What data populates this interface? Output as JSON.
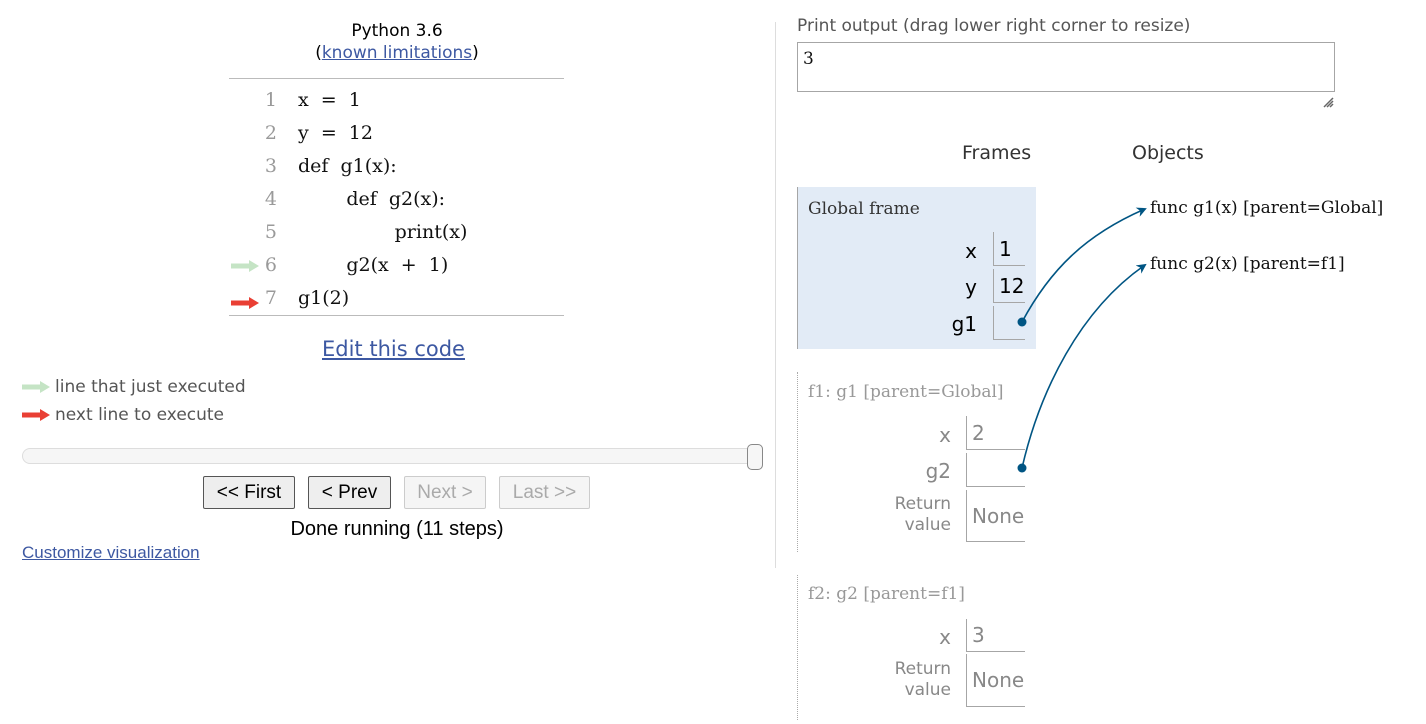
{
  "header": {
    "language": "Python 3.6",
    "limitations_open": "(",
    "limitations_link": "known limitations",
    "limitations_close": ")"
  },
  "code": {
    "lines": [
      {
        "number": "1",
        "text": "x  =  1",
        "marker": "none"
      },
      {
        "number": "2",
        "text": "y  =  12",
        "marker": "none"
      },
      {
        "number": "3",
        "text": "def  g1(x):",
        "marker": "none"
      },
      {
        "number": "4",
        "text": "        def  g2(x):",
        "marker": "none"
      },
      {
        "number": "5",
        "text": "                print(x)",
        "marker": "none"
      },
      {
        "number": "6",
        "text": "        g2(x  +  1)",
        "marker": "just-executed"
      },
      {
        "number": "7",
        "text": "g1(2)",
        "marker": "next-to-execute"
      }
    ]
  },
  "edit_link": "Edit this code",
  "legend": {
    "just_executed": "line that just executed",
    "next_line": "next line to execute",
    "just_executed_color": "#c5e4c5",
    "next_line_color": "#e93f34"
  },
  "navigation": {
    "slider_progress": 1.0,
    "first": "<< First",
    "prev": "< Prev",
    "next": "Next >",
    "last": "Last >>",
    "status": "Done running (11 steps)"
  },
  "customize_link": "Customize visualization",
  "print_output": {
    "label": "Print output (drag lower right corner to resize)",
    "value": "3"
  },
  "visualization": {
    "frames_heading": "Frames",
    "objects_heading": "Objects",
    "arrow_color": "#005583",
    "global_frame": {
      "title": "Global frame",
      "vars": [
        {
          "name": "x",
          "value": "1"
        },
        {
          "name": "y",
          "value": "12"
        },
        {
          "name": "g1",
          "value": ""
        }
      ]
    },
    "f1_frame": {
      "title": "f1: g1 [parent=Global]",
      "vars": [
        {
          "name": "x",
          "value": "2"
        },
        {
          "name": "g2",
          "value": ""
        }
      ],
      "return_label_1": "Return",
      "return_label_2": "value",
      "return_value": "None"
    },
    "f2_frame": {
      "title": "f2: g2 [parent=f1]",
      "vars": [
        {
          "name": "x",
          "value": "3"
        }
      ],
      "return_label_1": "Return",
      "return_label_2": "value",
      "return_value": "None"
    },
    "objects": [
      {
        "label": "func g1(x) [parent=Global]"
      },
      {
        "label": "func g2(x) [parent=f1]"
      }
    ]
  }
}
